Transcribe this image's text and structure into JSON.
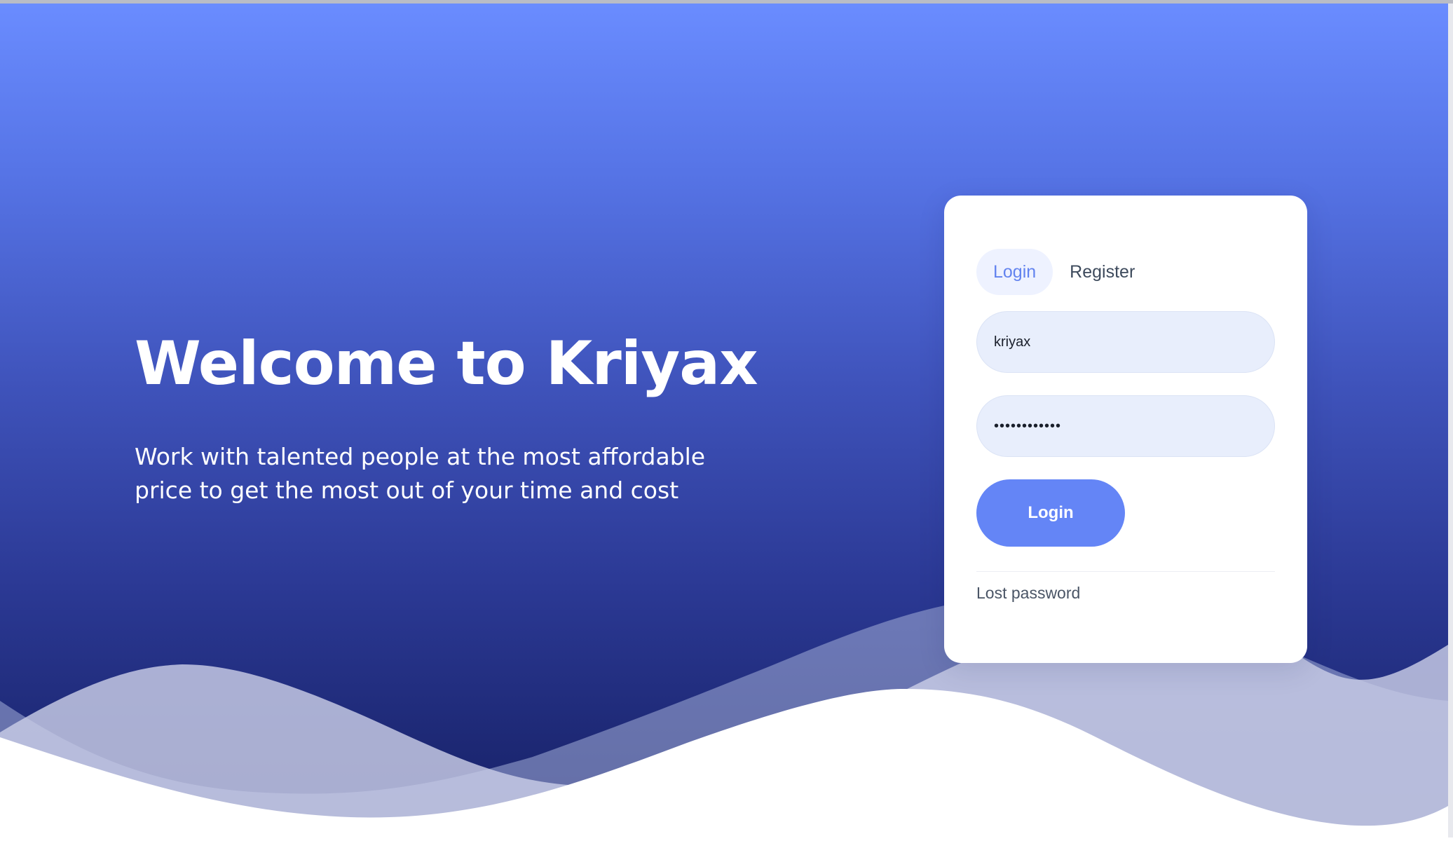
{
  "hero": {
    "title": "Welcome to Kriyax",
    "subtitle": "Work with talented people at the most affordable price to get the most out of your time and cost"
  },
  "login_card": {
    "tabs": [
      {
        "label": "Login",
        "active": true
      },
      {
        "label": "Register",
        "active": false
      }
    ],
    "username": {
      "value": "kriyax"
    },
    "password": {
      "value": "kriyaxkriyax"
    },
    "login_button_label": "Login",
    "lost_password_label": "Lost password"
  },
  "colors": {
    "gradient_top": "#6a8cff",
    "gradient_bottom": "#172068",
    "accent": "#6485f6",
    "input_background": "#e8eefc",
    "active_tab_background": "#eef2ff"
  }
}
